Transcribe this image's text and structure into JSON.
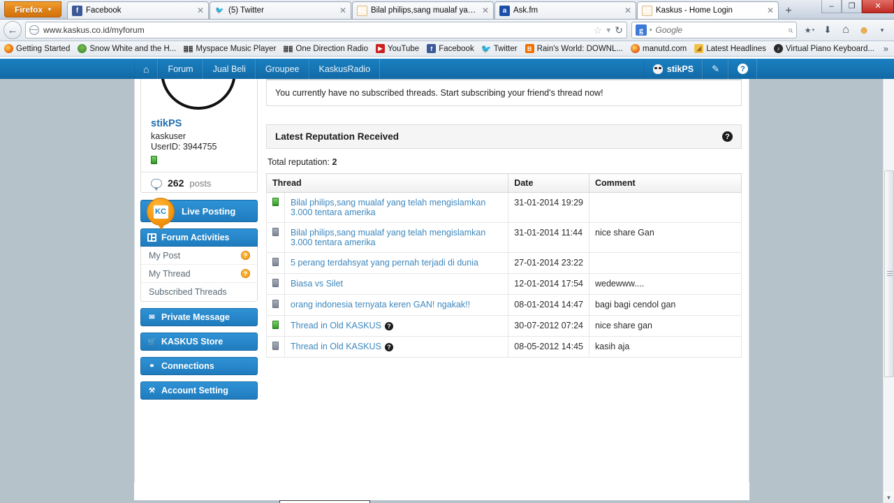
{
  "browser": {
    "app_button": {
      "label": "Firefox",
      "caret": "▾"
    },
    "tabs": [
      {
        "title": "Facebook",
        "favicon": "facebook-icon",
        "glyph": "f",
        "active": false
      },
      {
        "title": "(5) Twitter",
        "favicon": "twitter-icon",
        "glyph": "▶",
        "active": false
      },
      {
        "title": "Bilal philips,sang mualaf yang te...",
        "favicon": "kaskus-icon",
        "glyph": "KC",
        "active": false
      },
      {
        "title": "Ask.fm",
        "favicon": "askfm-icon",
        "glyph": "a",
        "active": false
      },
      {
        "title": "Kaskus - Home Login",
        "favicon": "kaskus-icon",
        "glyph": "KC",
        "active": true
      }
    ],
    "new_tab_label": "+",
    "window_controls": {
      "minimize": "–",
      "maximize": "❐",
      "close": "✕"
    },
    "back_button": "←",
    "url": "www.kaskus.co.id/myforum",
    "url_star": "☆",
    "url_caret": "▾",
    "url_reload": "↻",
    "search": {
      "engine": "Google",
      "badge": "g",
      "caret": "▾",
      "magnifier": "⌕"
    },
    "toolbar_icons": [
      {
        "name": "bookmarks-icon",
        "glyph": "★",
        "caret": "▾"
      },
      {
        "name": "downloads-icon",
        "glyph": "⬇"
      },
      {
        "name": "home-icon",
        "glyph": "⌂"
      },
      {
        "name": "user-avatar-icon",
        "glyph": "☺"
      },
      {
        "name": "overflow-caret-icon",
        "glyph": "▾"
      }
    ],
    "bookmarks": [
      {
        "label": "Getting Started",
        "icon": "firefox-icon",
        "glyph": ""
      },
      {
        "label": "Snow White and the H...",
        "icon": "snowwhite-icon",
        "glyph": ""
      },
      {
        "label": "Myspace Music Player",
        "icon": "myspace-icon",
        "glyph": "☰"
      },
      {
        "label": "One Direction Radio",
        "icon": "myspace-icon",
        "glyph": "☰"
      },
      {
        "label": "YouTube",
        "icon": "youtube-icon",
        "glyph": "▶"
      },
      {
        "label": "Facebook",
        "icon": "facebook-icon",
        "glyph": "f"
      },
      {
        "label": "Twitter",
        "icon": "twitter-icon",
        "glyph": "▶"
      },
      {
        "label": "Rain's World: DOWNL...",
        "icon": "blogger-icon",
        "glyph": "B"
      },
      {
        "label": "manutd.com",
        "icon": "manutd-icon",
        "glyph": ""
      },
      {
        "label": "Latest Headlines",
        "icon": "rss-icon",
        "glyph": "◢"
      },
      {
        "label": "Virtual Piano Keyboard...",
        "icon": "piano-icon",
        "glyph": "♪"
      }
    ],
    "bookmarks_overflow": "»"
  },
  "site_nav": {
    "home_icon": "home-icon",
    "home_glyph": "⌂",
    "items": [
      "Forum",
      "Jual Beli",
      "Groupee",
      "KaskusRadio"
    ],
    "username": "stikPS",
    "edit_glyph": "✎",
    "help_glyph": "?"
  },
  "sidebar": {
    "profile": {
      "name": "stikPS",
      "role": "kaskuser",
      "userid": "UserID: 3944755",
      "posts_count": "262",
      "posts_label": "posts"
    },
    "live_posting": {
      "label": "Live Posting",
      "badge_glyph": "KC"
    },
    "forum_activities": {
      "label": "Forum Activities",
      "items": [
        {
          "label": "My Post",
          "badge": "?"
        },
        {
          "label": "My Thread",
          "badge": "?"
        },
        {
          "label": "Subscribed Threads",
          "badge": ""
        }
      ]
    },
    "buttons": [
      {
        "label": "Private Message",
        "icon": "envelope-icon",
        "glyph": "✉"
      },
      {
        "label": "KASKUS Store",
        "icon": "cart-icon",
        "glyph": "🛒"
      },
      {
        "label": "Connections",
        "icon": "connections-icon",
        "glyph": "⚭"
      },
      {
        "label": "Account Setting",
        "icon": "wrench-icon",
        "glyph": "⚒"
      }
    ]
  },
  "main": {
    "notice": "You currently have no subscribed threads. Start subscribing your friend's thread now!",
    "section_title": "Latest Reputation Received",
    "section_help_glyph": "?",
    "total_reputation_label": "Total reputation:",
    "total_reputation_value": "2",
    "table": {
      "columns": [
        "Thread",
        "Date",
        "Comment"
      ],
      "rows": [
        {
          "flag": "green",
          "thread": "Bilal philips,sang mualaf yang telah mengislamkan 3.000 tentara amerika",
          "help": false,
          "date": "31-01-2014 19:29",
          "comment": ""
        },
        {
          "flag": "gray",
          "thread": "Bilal philips,sang mualaf yang telah mengislamkan 3.000 tentara amerika",
          "help": false,
          "date": "31-01-2014 11:44",
          "comment": "nice share Gan"
        },
        {
          "flag": "gray",
          "thread": "5 perang terdahsyat yang pernah terjadi di dunia",
          "help": false,
          "date": "27-01-2014 23:22",
          "comment": ""
        },
        {
          "flag": "gray",
          "thread": "Biasa vs Silet",
          "help": false,
          "date": "12-01-2014 17:54",
          "comment": "wedewww...."
        },
        {
          "flag": "gray",
          "thread": "orang indonesia ternyata keren GAN! ngakak!!",
          "help": false,
          "date": "08-01-2014 14:47",
          "comment": "bagi bagi cendol gan"
        },
        {
          "flag": "green",
          "thread": "Thread in Old KASKUS",
          "help": true,
          "date": "30-07-2012 07:24",
          "comment": "nice share gan"
        },
        {
          "flag": "gray",
          "thread": "Thread in Old KASKUS",
          "help": true,
          "date": "08-05-2012 14:45",
          "comment": "kasih aja"
        }
      ]
    }
  },
  "scrollbar": {
    "up_glyph": "▲",
    "down_glyph": "▼"
  },
  "colors": {
    "kaskus_blue": "#1675b4",
    "button_blue": "#1f7cbe",
    "link_blue": "#3d87bd",
    "page_bg": "#b6c2ca",
    "green_flag": "#2f9a22",
    "gray_flag": "#7e8596",
    "orange": "#f0920c"
  }
}
